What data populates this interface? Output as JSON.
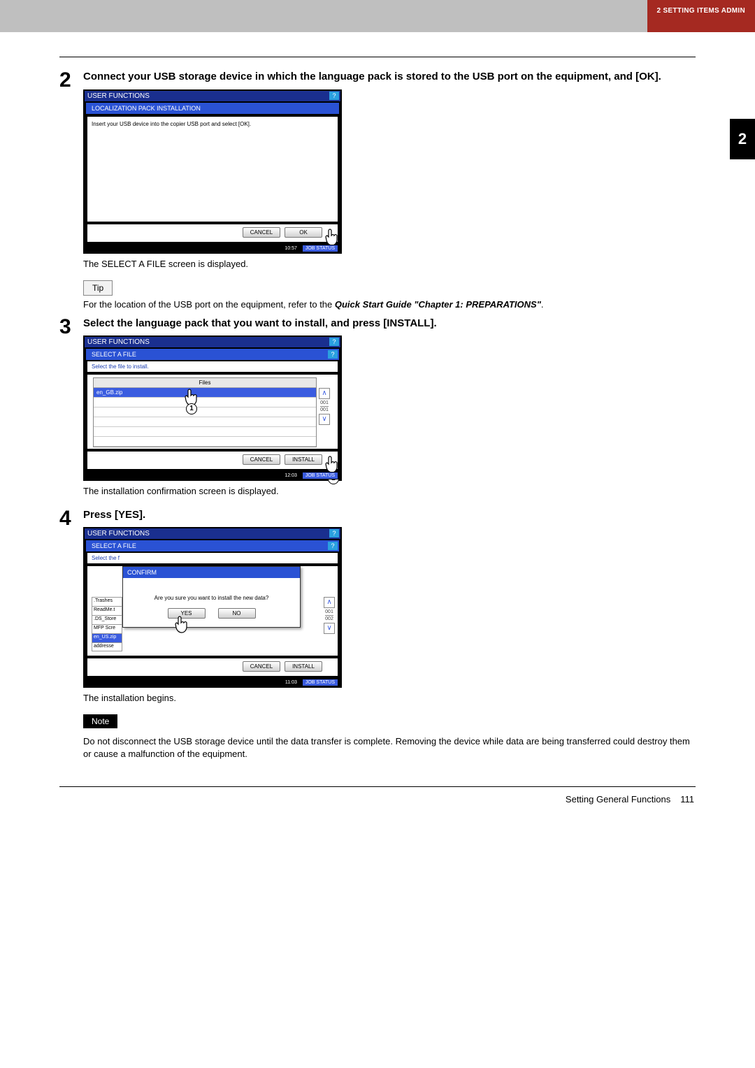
{
  "header": {
    "tab": "2 SETTING ITEMS ADMIN",
    "side_chapter": "2"
  },
  "step2": {
    "num": "2",
    "heading": "Connect your USB storage device in which the language pack is stored to the USB port on the equipment, and [OK].",
    "after": "The SELECT A FILE screen is displayed.",
    "tip_label": "Tip",
    "tip_text_a": "For the location of the USB port on the equipment, refer to the ",
    "tip_text_b": "Quick Start Guide \"Chapter 1: PREPARATIONS\"",
    "tip_text_c": "."
  },
  "step3": {
    "num": "3",
    "heading": "Select the language pack that you want to install, and press [INSTALL].",
    "after": "The installation confirmation screen is displayed."
  },
  "step4": {
    "num": "4",
    "heading": "Press [YES].",
    "after": "The installation begins.",
    "note_label": "Note",
    "note_text": "Do not disconnect the USB storage device until the data transfer is complete. Removing the device while data are being transferred could destroy them or cause a malfunction of the equipment."
  },
  "device_common": {
    "title": "USER FUNCTIONS",
    "help": "?",
    "cancel": "CANCEL",
    "ok": "OK",
    "install": "INSTALL",
    "jobstatus": "JOB STATUS"
  },
  "shot1": {
    "subbar": "LOCALIZATION PACK INSTALLATION",
    "msg": "Insert your USB device into the copier USB port and select [OK].",
    "time": "10:57"
  },
  "shot2": {
    "subbar": "SELECT A FILE",
    "info": "Select the file to install.",
    "files_header": "Files",
    "file_selected": "en_GB.zip",
    "pager1": "001",
    "pager2": "001",
    "time": "12:03",
    "key1": "1",
    "key2": "2"
  },
  "shot3": {
    "subbar": "SELECT A FILE",
    "info": "Select the f",
    "leftfiles": [
      ".Trashes",
      "ReadMe.t",
      ".DS_Store",
      "MFP Scre",
      "en_US.zip",
      "addresse"
    ],
    "dlg_title": "CONFIRM",
    "dlg_msg": "Are you sure you want to install the new data?",
    "yes": "YES",
    "no": "NO",
    "pager1": "001",
    "pager2": "002",
    "time": "11:03"
  },
  "footer": {
    "label": "Setting General Functions",
    "page": "111"
  }
}
